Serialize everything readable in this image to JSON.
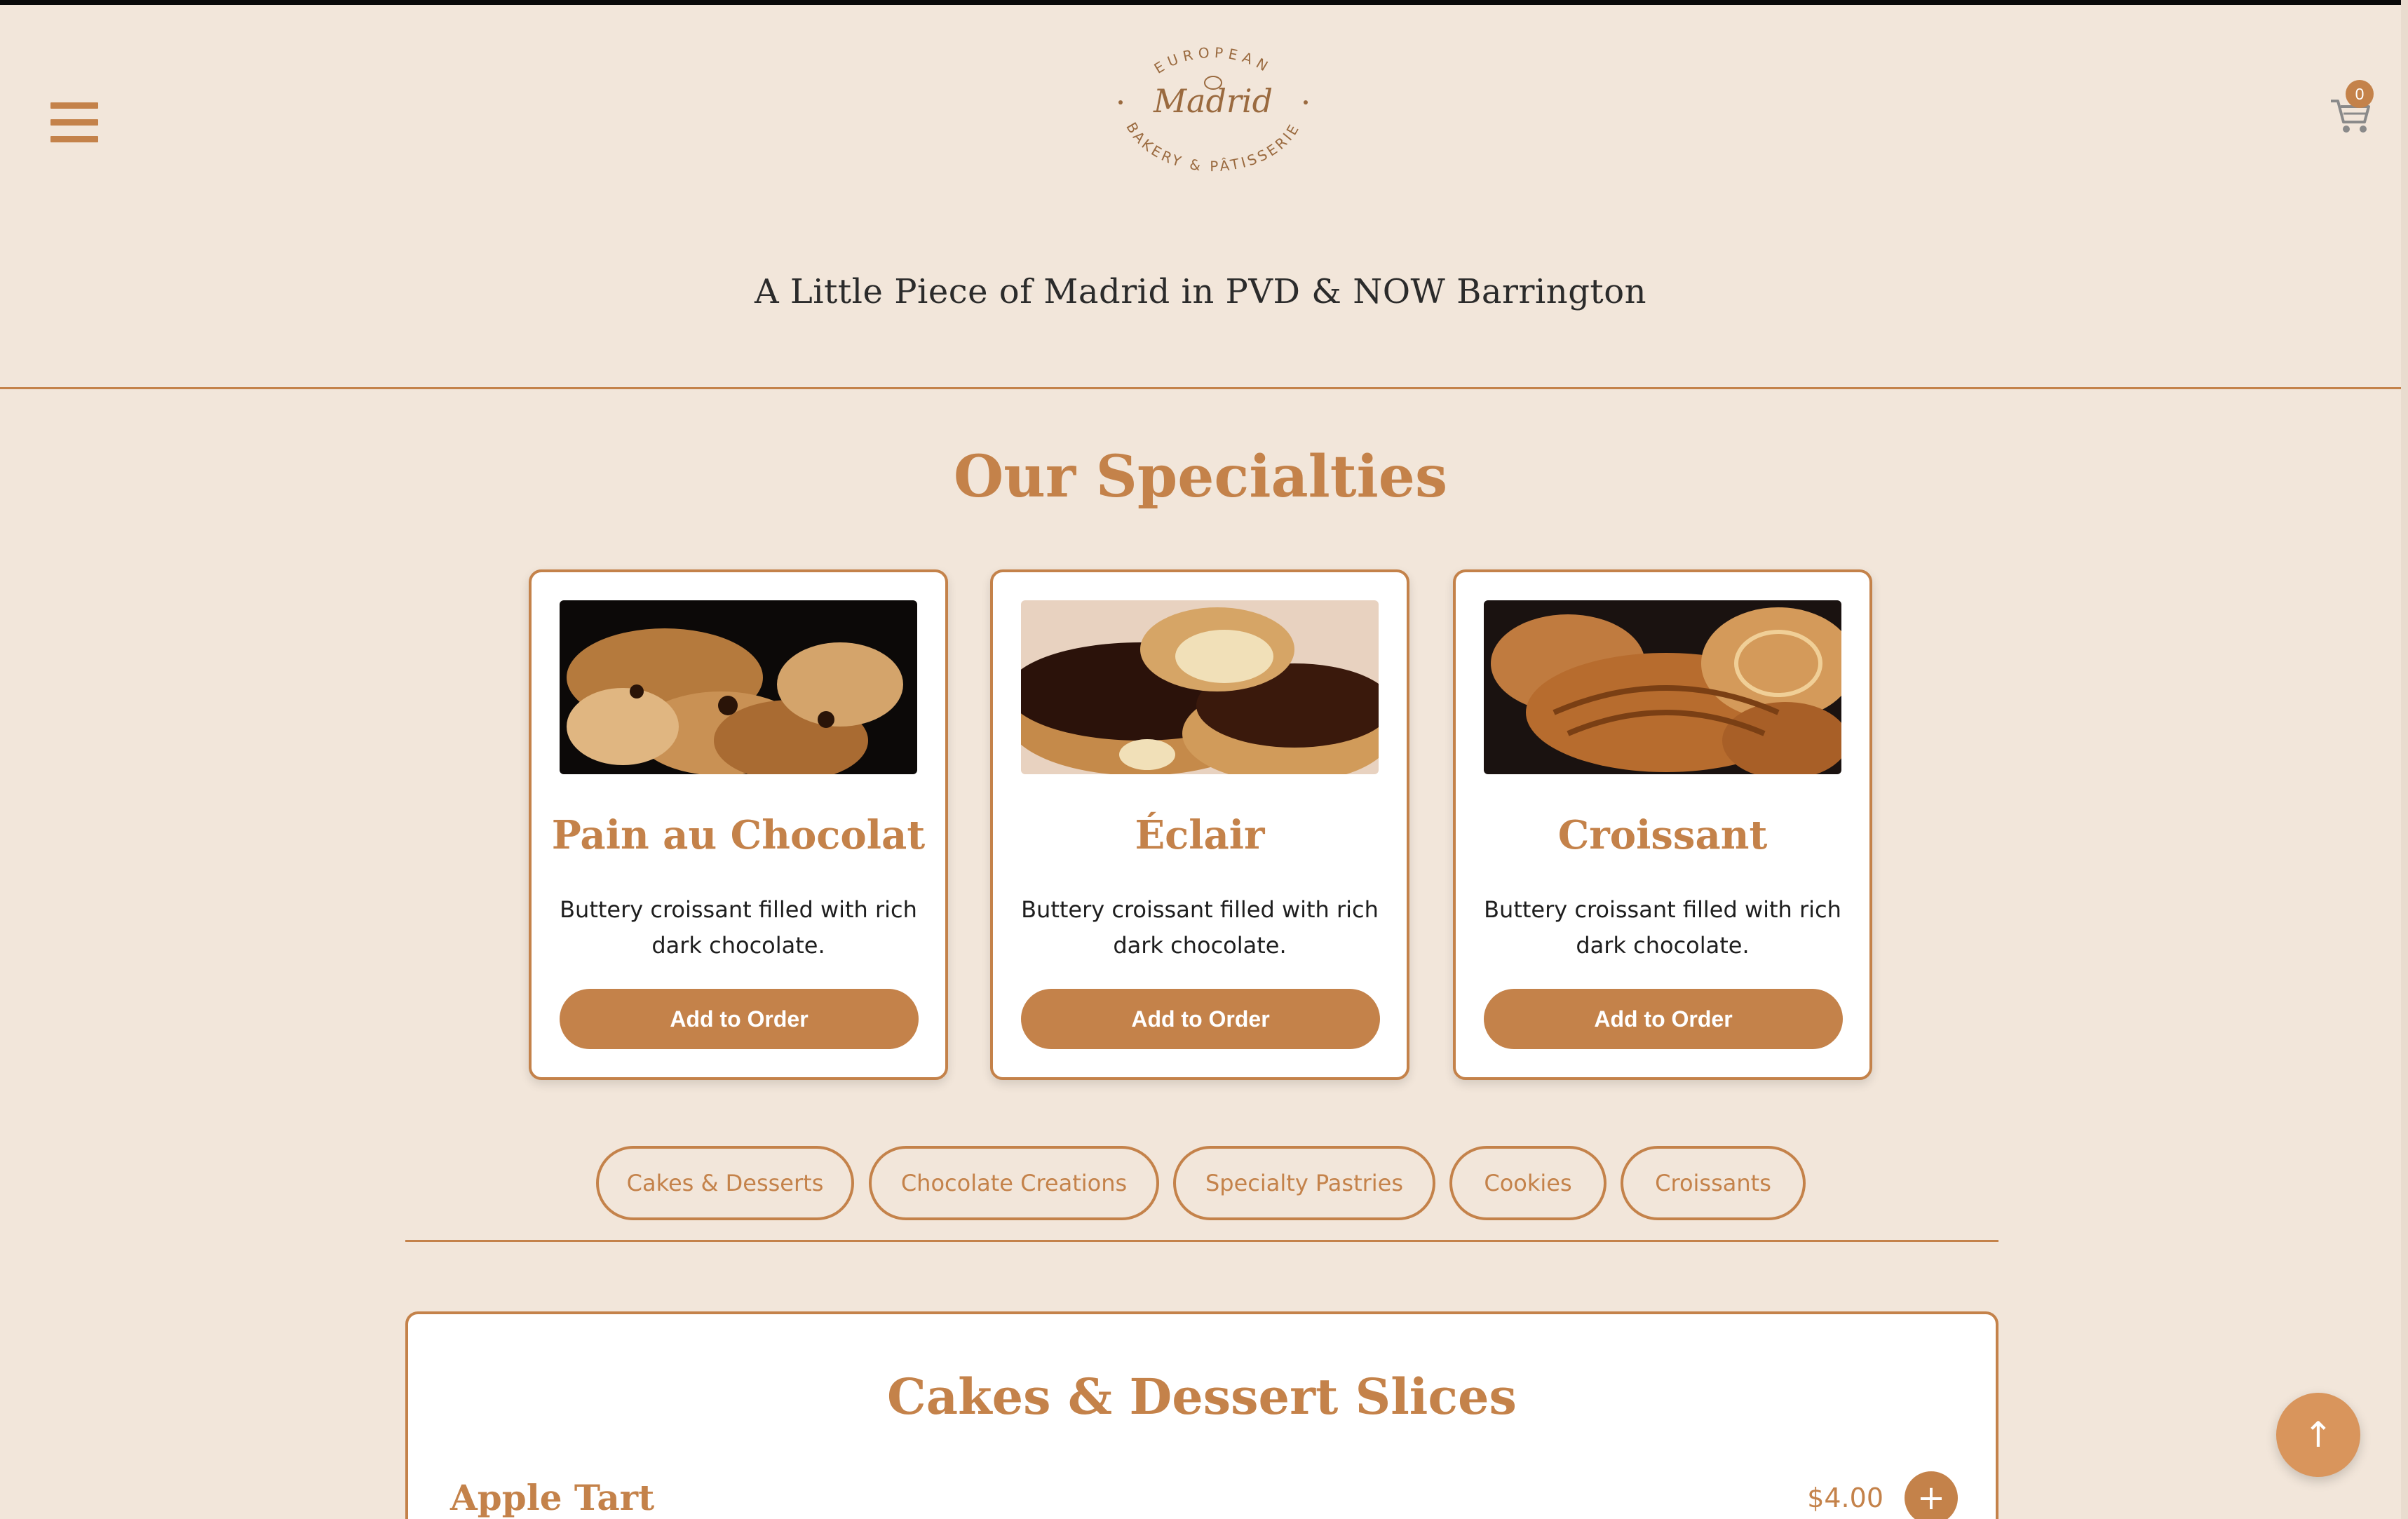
{
  "header": {
    "logo": {
      "top_text": "EUROPEAN",
      "name": "Madrid",
      "bottom_text": "BAKERY & PÂTISSERIE"
    },
    "cart_count": "0",
    "tagline": "A Little Piece of Madrid in PVD & NOW Barrington"
  },
  "specialties": {
    "title": "Our Specialties",
    "items": [
      {
        "name": "Pain au Chocolat",
        "description": "Buttery croissant filled with rich dark chocolate.",
        "button": "Add to Order"
      },
      {
        "name": "Éclair",
        "description": "Buttery croissant filled with rich dark chocolate.",
        "button": "Add to Order"
      },
      {
        "name": "Croissant",
        "description": "Buttery croissant filled with rich dark chocolate.",
        "button": "Add to Order"
      }
    ]
  },
  "categories": [
    "Cakes & Desserts",
    "Chocolate Creations",
    "Specialty Pastries",
    "Cookies",
    "Croissants"
  ],
  "menu_section": {
    "title": "Cakes & Dessert Slices",
    "items": [
      {
        "name": "Apple Tart",
        "price": "$4.00",
        "add_symbol": "+"
      }
    ]
  },
  "scroll_top_symbol": "↑",
  "colors": {
    "accent": "#c4824a",
    "background": "#f2e6da",
    "card": "#ffffff"
  }
}
